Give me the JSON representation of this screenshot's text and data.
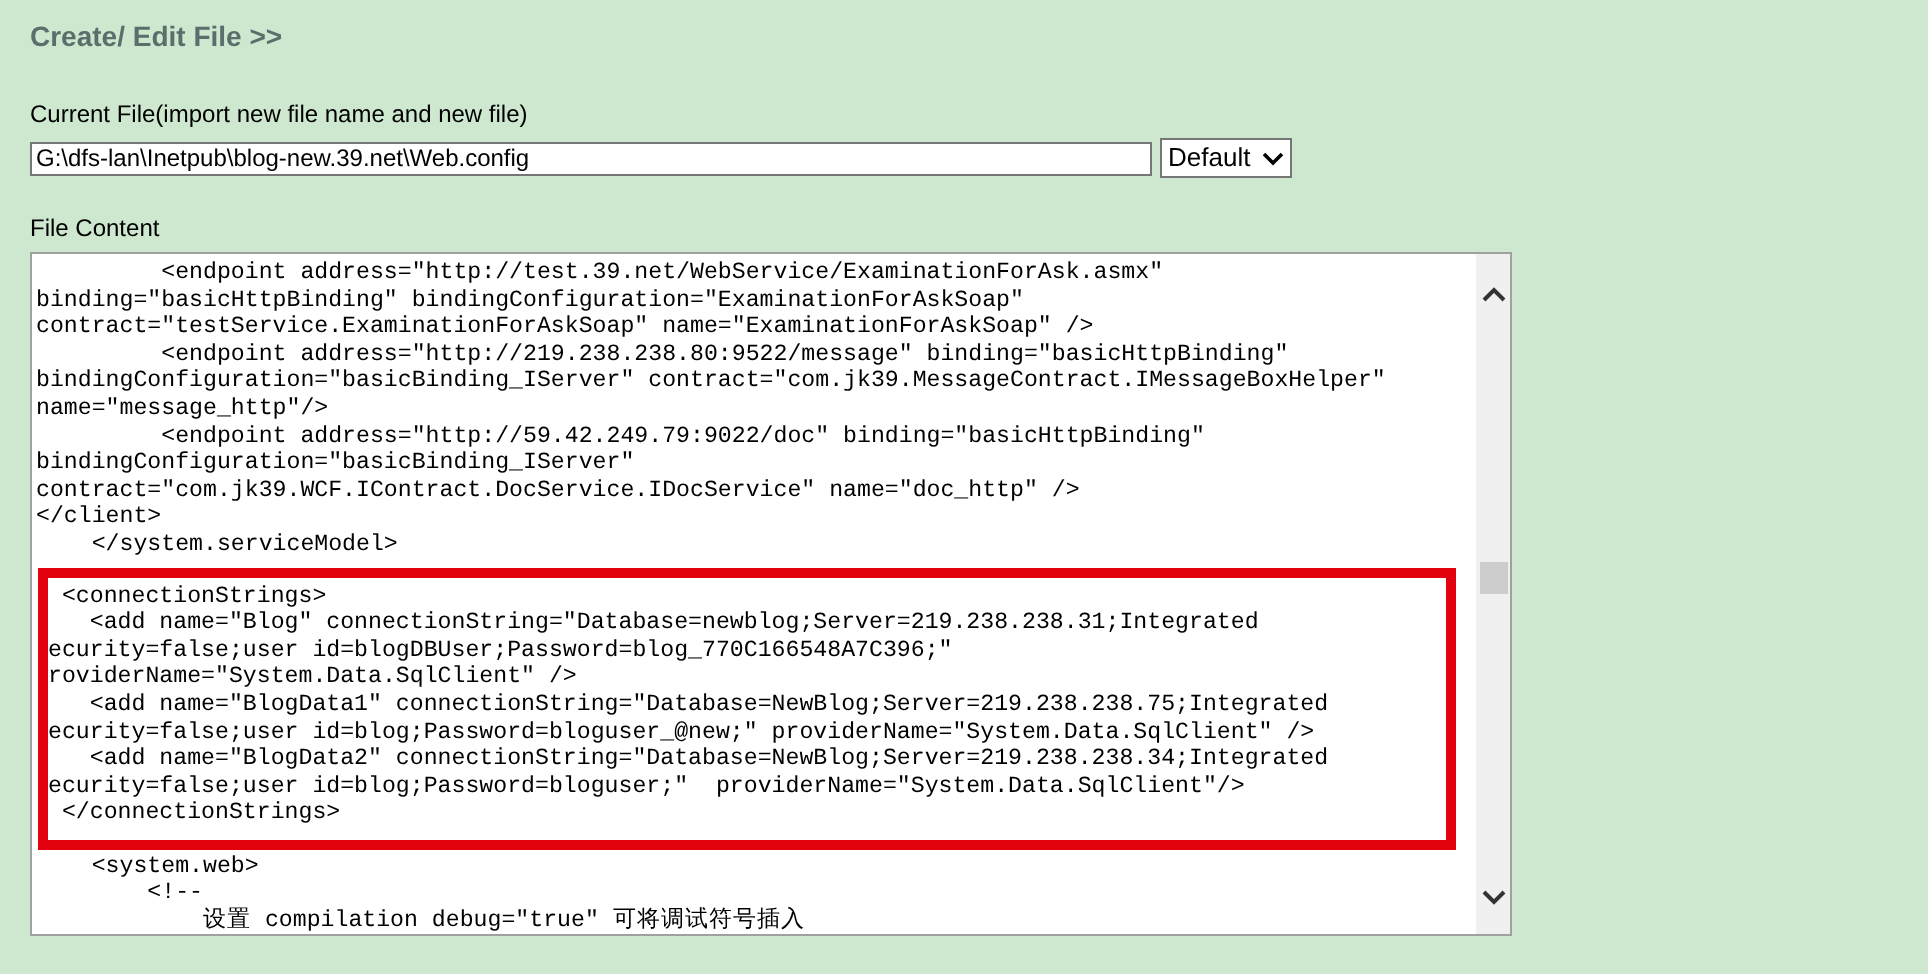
{
  "heading": "Create/ Edit File >>",
  "current_file": {
    "label": "Current File(import new file name and new file)",
    "value": "G:\\dfs-lan\\Inetpub\\blog-new.39.net\\Web.config",
    "encoding": "Default"
  },
  "file_content": {
    "label": "File Content",
    "lines_before": [
      "         <endpoint address=\"http://test.39.net/WebService/ExaminationForAsk.asmx\"",
      "binding=\"basicHttpBinding\" bindingConfiguration=\"ExaminationForAskSoap\"",
      "contract=\"testService.ExaminationForAskSoap\" name=\"ExaminationForAskSoap\" />",
      "         <endpoint address=\"http://219.238.238.80:9522/message\" binding=\"basicHttpBinding\"",
      "bindingConfiguration=\"basicBinding_IServer\" contract=\"com.jk39.MessageContract.IMessageBoxHelper\"",
      "name=\"message_http\"/>",
      "         <endpoint address=\"http://59.42.249.79:9022/doc\" binding=\"basicHttpBinding\"",
      "bindingConfiguration=\"basicBinding_IServer\"",
      "contract=\"com.jk39.WCF.IContract.DocService.IDocService\" name=\"doc_http\" />",
      "</client>",
      "    </system.serviceModel>"
    ],
    "highlighted_lines": [
      " <connectionStrings>",
      "   <add name=\"Blog\" connectionString=\"Database=newblog;Server=219.238.238.31;Integrated",
      "ecurity=false;user id=blogDBUser;Password=blog_770C166548A7C396;\"",
      "roviderName=\"System.Data.SqlClient\" />",
      "   <add name=\"BlogData1\" connectionString=\"Database=NewBlog;Server=219.238.238.75;Integrated",
      "ecurity=false;user id=blog;Password=bloguser_@new;\" providerName=\"System.Data.SqlClient\" />",
      "   <add name=\"BlogData2\" connectionString=\"Database=NewBlog;Server=219.238.238.34;Integrated",
      "ecurity=false;user id=blog;Password=bloguser;\"  providerName=\"System.Data.SqlClient\"/>",
      " </connectionStrings>"
    ],
    "lines_after": [
      "    <system.web>",
      "        <!--",
      "            设置 compilation debug=\"true\" 可将调试符号插入"
    ]
  }
}
